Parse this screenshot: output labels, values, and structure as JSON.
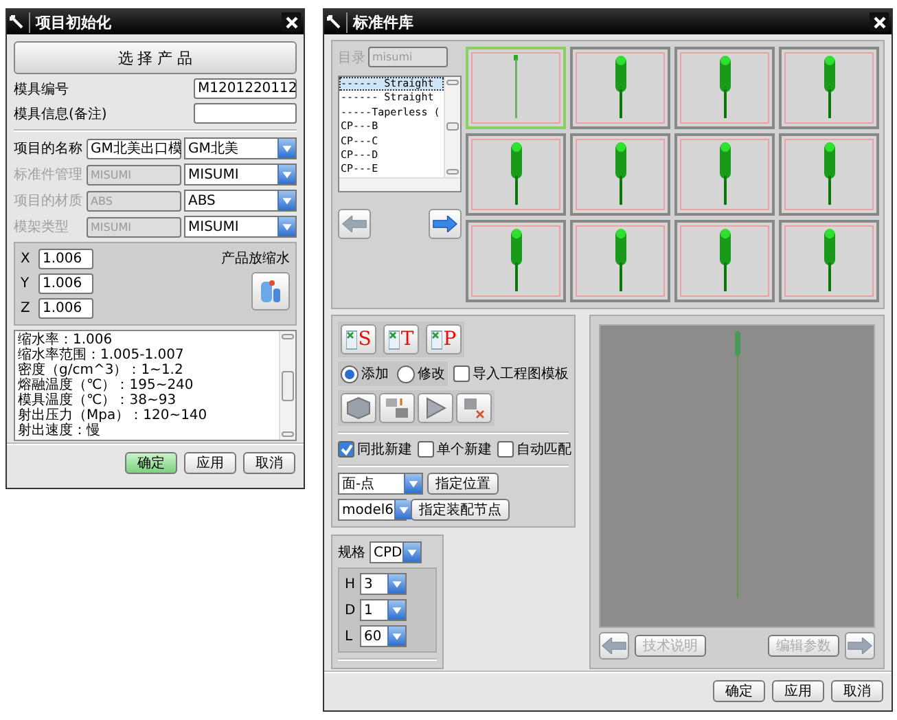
{
  "project_dialog": {
    "title": "项目初始化",
    "select_button": "选 择 产 品",
    "fields": [
      {
        "label": "模具编号",
        "value": "M1201220112"
      },
      {
        "label": "模具信息(备注)"
      }
    ],
    "rows": [
      {
        "label": "项目的名称",
        "disabled": false,
        "text": "GM北美出口模",
        "choice": "GM北美"
      },
      {
        "label": "标准件管理",
        "disabled": true,
        "text": "MISUMI",
        "choice": "MISUMI"
      },
      {
        "label": "项目的材质",
        "disabled": true,
        "text": "ABS",
        "choice": "ABS"
      },
      {
        "label": "模架类型",
        "disabled": true,
        "text": "MISUMI",
        "choice": "MISUMI"
      }
    ],
    "scale": {
      "label": "产品放缩水",
      "axes": [
        {
          "label": "X",
          "value": "1.006"
        },
        {
          "label": "Y",
          "value": "1.006"
        },
        {
          "label": "Z",
          "value": "1.006"
        }
      ]
    },
    "notes": [
      "缩水率：1.006",
      "缩水率范围：1.005-1.007",
      "密度（g/cm^3）：1~1.2",
      "熔融温度（℃）：195~240",
      "模具温度（℃）：38~93",
      "射出压力（Mpa）：120~140",
      "射出速度：慢"
    ],
    "buttons": [
      {
        "label": "确定",
        "default": true
      },
      {
        "label": "应用",
        "default": false
      },
      {
        "label": "取消",
        "default": false
      }
    ]
  },
  "library_dialog": {
    "title": "标准件库",
    "catalog": {
      "label": "目录",
      "value": "misumi",
      "disabled": true
    },
    "list": [
      {
        "label": "------ Straight",
        "selected": true
      },
      {
        "label": "------ Straight",
        "selected": false
      },
      {
        "label": "-----Taperless (",
        "selected": false
      },
      {
        "label": "CP---B",
        "selected": false
      },
      {
        "label": "CP---C",
        "selected": false
      },
      {
        "label": "CP---D",
        "selected": false
      },
      {
        "label": "CP---E",
        "selected": false
      }
    ],
    "nav": [
      {
        "kind": "prev",
        "disabled": true
      },
      {
        "kind": "next",
        "disabled": false
      }
    ],
    "thumbnails": [
      {
        "kind": "wire",
        "selected": true
      },
      {
        "kind": "rod",
        "selected": false
      },
      {
        "kind": "rod",
        "selected": false
      },
      {
        "kind": "rod",
        "selected": false
      },
      {
        "kind": "rod",
        "selected": false
      },
      {
        "kind": "rod",
        "selected": false
      },
      {
        "kind": "rod",
        "selected": false
      },
      {
        "kind": "rod",
        "selected": false
      },
      {
        "kind": "rod",
        "selected": false
      },
      {
        "kind": "rod",
        "selected": false
      },
      {
        "kind": "rod",
        "selected": false
      },
      {
        "kind": "rod",
        "selected": false
      }
    ],
    "templates": [
      {
        "letter": "S"
      },
      {
        "letter": "T"
      },
      {
        "letter": "P"
      }
    ],
    "modes": [
      {
        "label": "添加",
        "selected": true
      },
      {
        "label": "修改",
        "selected": false
      }
    ],
    "import_template": {
      "label": "导入工程图模板",
      "checked": false
    },
    "tools": [
      {
        "kind": "block"
      },
      {
        "kind": "move"
      },
      {
        "kind": "play"
      },
      {
        "kind": "remove"
      }
    ],
    "options": [
      {
        "label": "同批新建",
        "checked": true
      },
      {
        "label": "单个新建",
        "checked": false
      },
      {
        "label": "自动匹配",
        "checked": false
      }
    ],
    "placement": {
      "value": "面-点",
      "button": "指定位置"
    },
    "node": {
      "value": "model6",
      "button": "指定装配节点"
    },
    "spec": {
      "label": "规格",
      "value": "CPD",
      "params": [
        {
          "label": "H",
          "value": "3"
        },
        {
          "label": "D",
          "value": "1"
        },
        {
          "label": "L",
          "value": "60"
        }
      ]
    },
    "preview": {
      "buttons": [
        {
          "label": "技术说明",
          "disabled": true
        },
        {
          "label": "编辑参数",
          "disabled": true
        }
      ],
      "arrows": [
        {
          "kind": "prev",
          "disabled": true
        },
        {
          "kind": "next",
          "disabled": true
        }
      ]
    },
    "buttons": [
      {
        "label": "确定"
      },
      {
        "label": "应用"
      },
      {
        "label": "取消"
      }
    ]
  }
}
